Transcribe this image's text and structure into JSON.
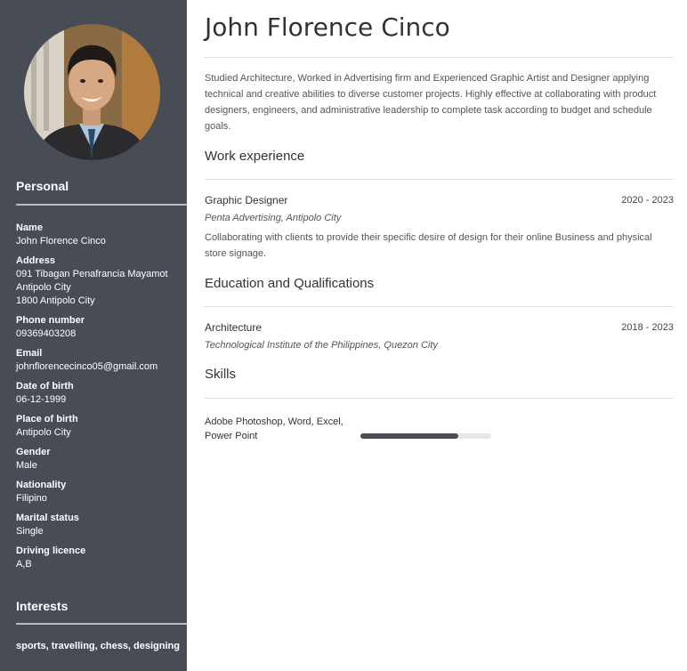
{
  "profile": {
    "photo_icon": "person-photo",
    "name": "John Florence Cinco",
    "summary": "Studied Architecture, Worked in Advertising firm and Experienced Graphic Artist and Designer applying technical and creative abilities to diverse customer projects. Highly effective at collaborating with product designers, engineers, and administrative leadership to complete task according to budget and schedule goals."
  },
  "personal": {
    "heading": "Personal",
    "fields": [
      {
        "label": "Name",
        "value": "John Florence Cinco"
      },
      {
        "label": "Address",
        "value": "091 Tibagan Penafrancia Mayamot\nAntipolo City\n1800 Antipolo City"
      },
      {
        "label": "Phone number",
        "value": "09369403208"
      },
      {
        "label": "Email",
        "value": "johnflorencecinco05@gmail.com"
      },
      {
        "label": "Date of birth",
        "value": "06-12-1999"
      },
      {
        "label": "Place of birth",
        "value": "Antipolo City"
      },
      {
        "label": "Gender",
        "value": "Male"
      },
      {
        "label": "Nationality",
        "value": "Filipino"
      },
      {
        "label": "Marital status",
        "value": "Single"
      },
      {
        "label": "Driving licence",
        "value": "A,B"
      }
    ]
  },
  "interests": {
    "heading": "Interests",
    "text": "sports, travelling, chess, designing"
  },
  "work": {
    "heading": "Work experience",
    "entries": [
      {
        "title": "Graphic Designer",
        "dates": "2020 - 2023",
        "place": "Penta Advertising, Antipolo City",
        "description": "Collaborating with clients to provide their specific desire of design for their online Business and physical store signage."
      }
    ]
  },
  "education": {
    "heading": "Education and Qualifications",
    "entries": [
      {
        "title": "Architecture",
        "dates": "2018 - 2023",
        "place": "Technological Institute of the Philippines, Quezon City"
      }
    ]
  },
  "skills": {
    "heading": "Skills",
    "items": [
      {
        "name": "Adobe Photoshop, Word, Excel, Power Point",
        "level": 0.75
      }
    ]
  },
  "colors": {
    "sidebar": "#474c55",
    "skill_fill": "#474c55",
    "skill_track": "#e6e7ea"
  }
}
